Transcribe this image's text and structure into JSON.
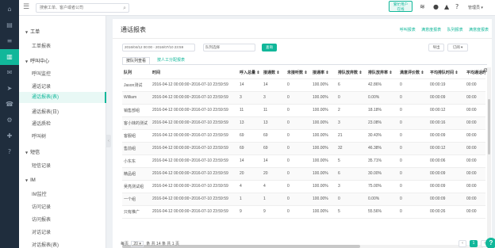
{
  "search": {
    "placeholder": "搜索工单、客户或者公司"
  },
  "status_badge": "繁忙用户\n在线",
  "user": {
    "name": "管理员 ▾"
  },
  "nav": {
    "groups": [
      {
        "label": "工单",
        "items": [
          "工单报表"
        ]
      },
      {
        "label": "呼叫中心",
        "items": [
          "呼叫监控",
          "通话记录",
          "通话报表(表)",
          "通话报表(日)",
          "通话质检",
          "呼叫树"
        ]
      },
      {
        "label": "短信",
        "items": [
          "短信记录"
        ]
      },
      {
        "label": "IM",
        "items": [
          "IM监控",
          "访问记录",
          "访问报表",
          "对话记录",
          "对话报表(表)"
        ]
      }
    ],
    "active_item": "通话报表(表)"
  },
  "page": {
    "title": "通话报表",
    "links": [
      "呼叫报表",
      "满意度报表",
      "队列报表",
      "满意度报表"
    ],
    "date_range": "2016/04/12 00:00 - 2016/07/10 23:59",
    "queue_select": "队列选择",
    "query_button": "查询",
    "export_button": "导出",
    "subscribe_button": "订阅 ▾",
    "tabs": [
      "按队列查看",
      "按人工分配报表"
    ]
  },
  "table": {
    "headers": [
      "队列",
      "时间",
      "呼入总量 ⇕",
      "接通数 ⇕",
      "未接听数 ⇕",
      "接通率 ⇕",
      "排队放弃数 ⇕",
      "排队放弃率 ⇕",
      "满意评价数 ⇕",
      "平均排队时间 ⇕",
      "平均通话时"
    ],
    "rows": [
      [
        "Jason测试",
        "2016-04-12 00:00:00~2016-07-10 23:59:59",
        "14",
        "14",
        "0",
        "100.00%",
        "6",
        "42.86%",
        "0",
        "00:00:19",
        "00:00"
      ],
      [
        "William",
        "2016-04-12 00:00:00~2016-07-10 23:59:59",
        "3",
        "3",
        "0",
        "100.00%",
        "0",
        "0.00%",
        "0",
        "00:00:09",
        "00:00"
      ],
      [
        "销售部组",
        "2016-04-12 00:00:00~2016-07-10 23:59:59",
        "11",
        "11",
        "0",
        "100.00%",
        "2",
        "18.18%",
        "0",
        "00:00:12",
        "00:00"
      ],
      [
        "客小妹的测试",
        "2016-04-12 00:00:00~2016-07-10 23:59:59",
        "13",
        "13",
        "0",
        "100.00%",
        "3",
        "23.08%",
        "0",
        "00:00:16",
        "00:00"
      ],
      [
        "客服组",
        "2016-04-12 00:00:00~2016-07-10 23:59:59",
        "69",
        "69",
        "0",
        "100.00%",
        "21",
        "30.43%",
        "0",
        "00:00:09",
        "00:00"
      ],
      [
        "售前组",
        "2016-04-12 00:00:00~2016-07-10 23:59:59",
        "69",
        "69",
        "0",
        "100.00%",
        "32",
        "46.38%",
        "0",
        "00:00:12",
        "00:00"
      ],
      [
        "小东东",
        "2016-04-12 00:00:00~2016-07-10 23:59:59",
        "14",
        "14",
        "0",
        "100.00%",
        "5",
        "35.71%",
        "0",
        "00:00:06",
        "00:00"
      ],
      [
        "精品组",
        "2016-04-12 00:00:00~2016-07-10 23:59:59",
        "20",
        "20",
        "0",
        "100.00%",
        "6",
        "30.00%",
        "0",
        "00:00:09",
        "00:00"
      ],
      [
        "吴亮测试组",
        "2016-04-12 00:00:00~2016-07-10 23:59:59",
        "4",
        "4",
        "0",
        "100.00%",
        "3",
        "75.00%",
        "0",
        "00:00:09",
        "00:00"
      ],
      [
        "一个组",
        "2016-04-12 00:00:00~2016-07-10 23:59:59",
        "1",
        "1",
        "0",
        "100.00%",
        "0",
        "0.00%",
        "0",
        "00:00:09",
        "00:00"
      ],
      [
        "只有推广",
        "2016-04-12 00:00:00~2016-07-10 23:59:59",
        "9",
        "9",
        "0",
        "100.00%",
        "5",
        "55.56%",
        "0",
        "00:00:26",
        "00:00"
      ]
    ]
  },
  "footer": {
    "per_page_label": "每页",
    "per_page_value": "20 ▾",
    "summary": "条 共 14 条 共 1 页",
    "current_page": "1"
  },
  "colors": {
    "accent": "#11b79a",
    "rail": "#1f2d3d"
  }
}
